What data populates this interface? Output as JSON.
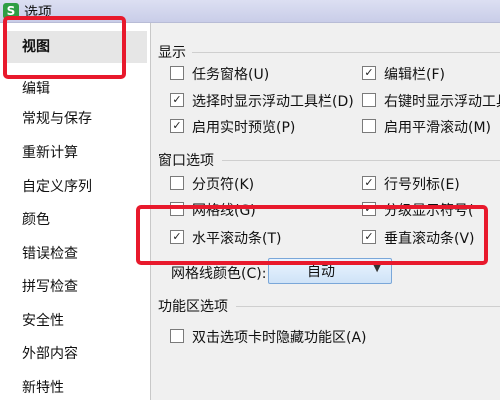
{
  "window": {
    "title": "选项",
    "app_icon_glyph": "S"
  },
  "sidebar": {
    "items": [
      {
        "label": "视图",
        "selected": true
      },
      {
        "label": "编辑"
      },
      {
        "label": "常规与保存"
      },
      {
        "label": "重新计算"
      },
      {
        "label": "自定义序列"
      },
      {
        "label": "颜色"
      },
      {
        "label": "错误检查"
      },
      {
        "label": "拼写检查"
      },
      {
        "label": "安全性"
      },
      {
        "label": "外部内容"
      },
      {
        "label": "新特性"
      }
    ]
  },
  "sections": {
    "display": {
      "title": "显示",
      "options": [
        {
          "label": "任务窗格(U)",
          "checked": false
        },
        {
          "label": "编辑栏(F)",
          "checked": true
        },
        {
          "label": "选择时显示浮动工具栏(D)",
          "checked": true
        },
        {
          "label": "右键时显示浮动工具",
          "checked": false
        },
        {
          "label": "启用实时预览(P)",
          "checked": true
        },
        {
          "label": "启用平滑滚动(M)",
          "checked": false
        }
      ]
    },
    "window_options": {
      "title": "窗口选项",
      "options": [
        {
          "label": "分页符(K)",
          "checked": false
        },
        {
          "label": "行号列标(E)",
          "checked": true
        },
        {
          "label": "网格线(G)",
          "checked": false
        },
        {
          "label": "分级显示符号(",
          "checked": true
        },
        {
          "label": "水平滚动条(T)",
          "checked": true
        },
        {
          "label": "垂直滚动条(V)",
          "checked": true
        }
      ],
      "gridline_color_label": "网格线颜色(C):",
      "gridline_color_value": "自动"
    },
    "ribbon": {
      "title": "功能区选项",
      "options": [
        {
          "label": "双击选项卡时隐藏功能区(A)",
          "checked": false
        }
      ]
    }
  },
  "colors": {
    "annotation": "#e8192c",
    "sidebar_bg": "#ffffff",
    "panel_bg": "#f0f0f0"
  }
}
